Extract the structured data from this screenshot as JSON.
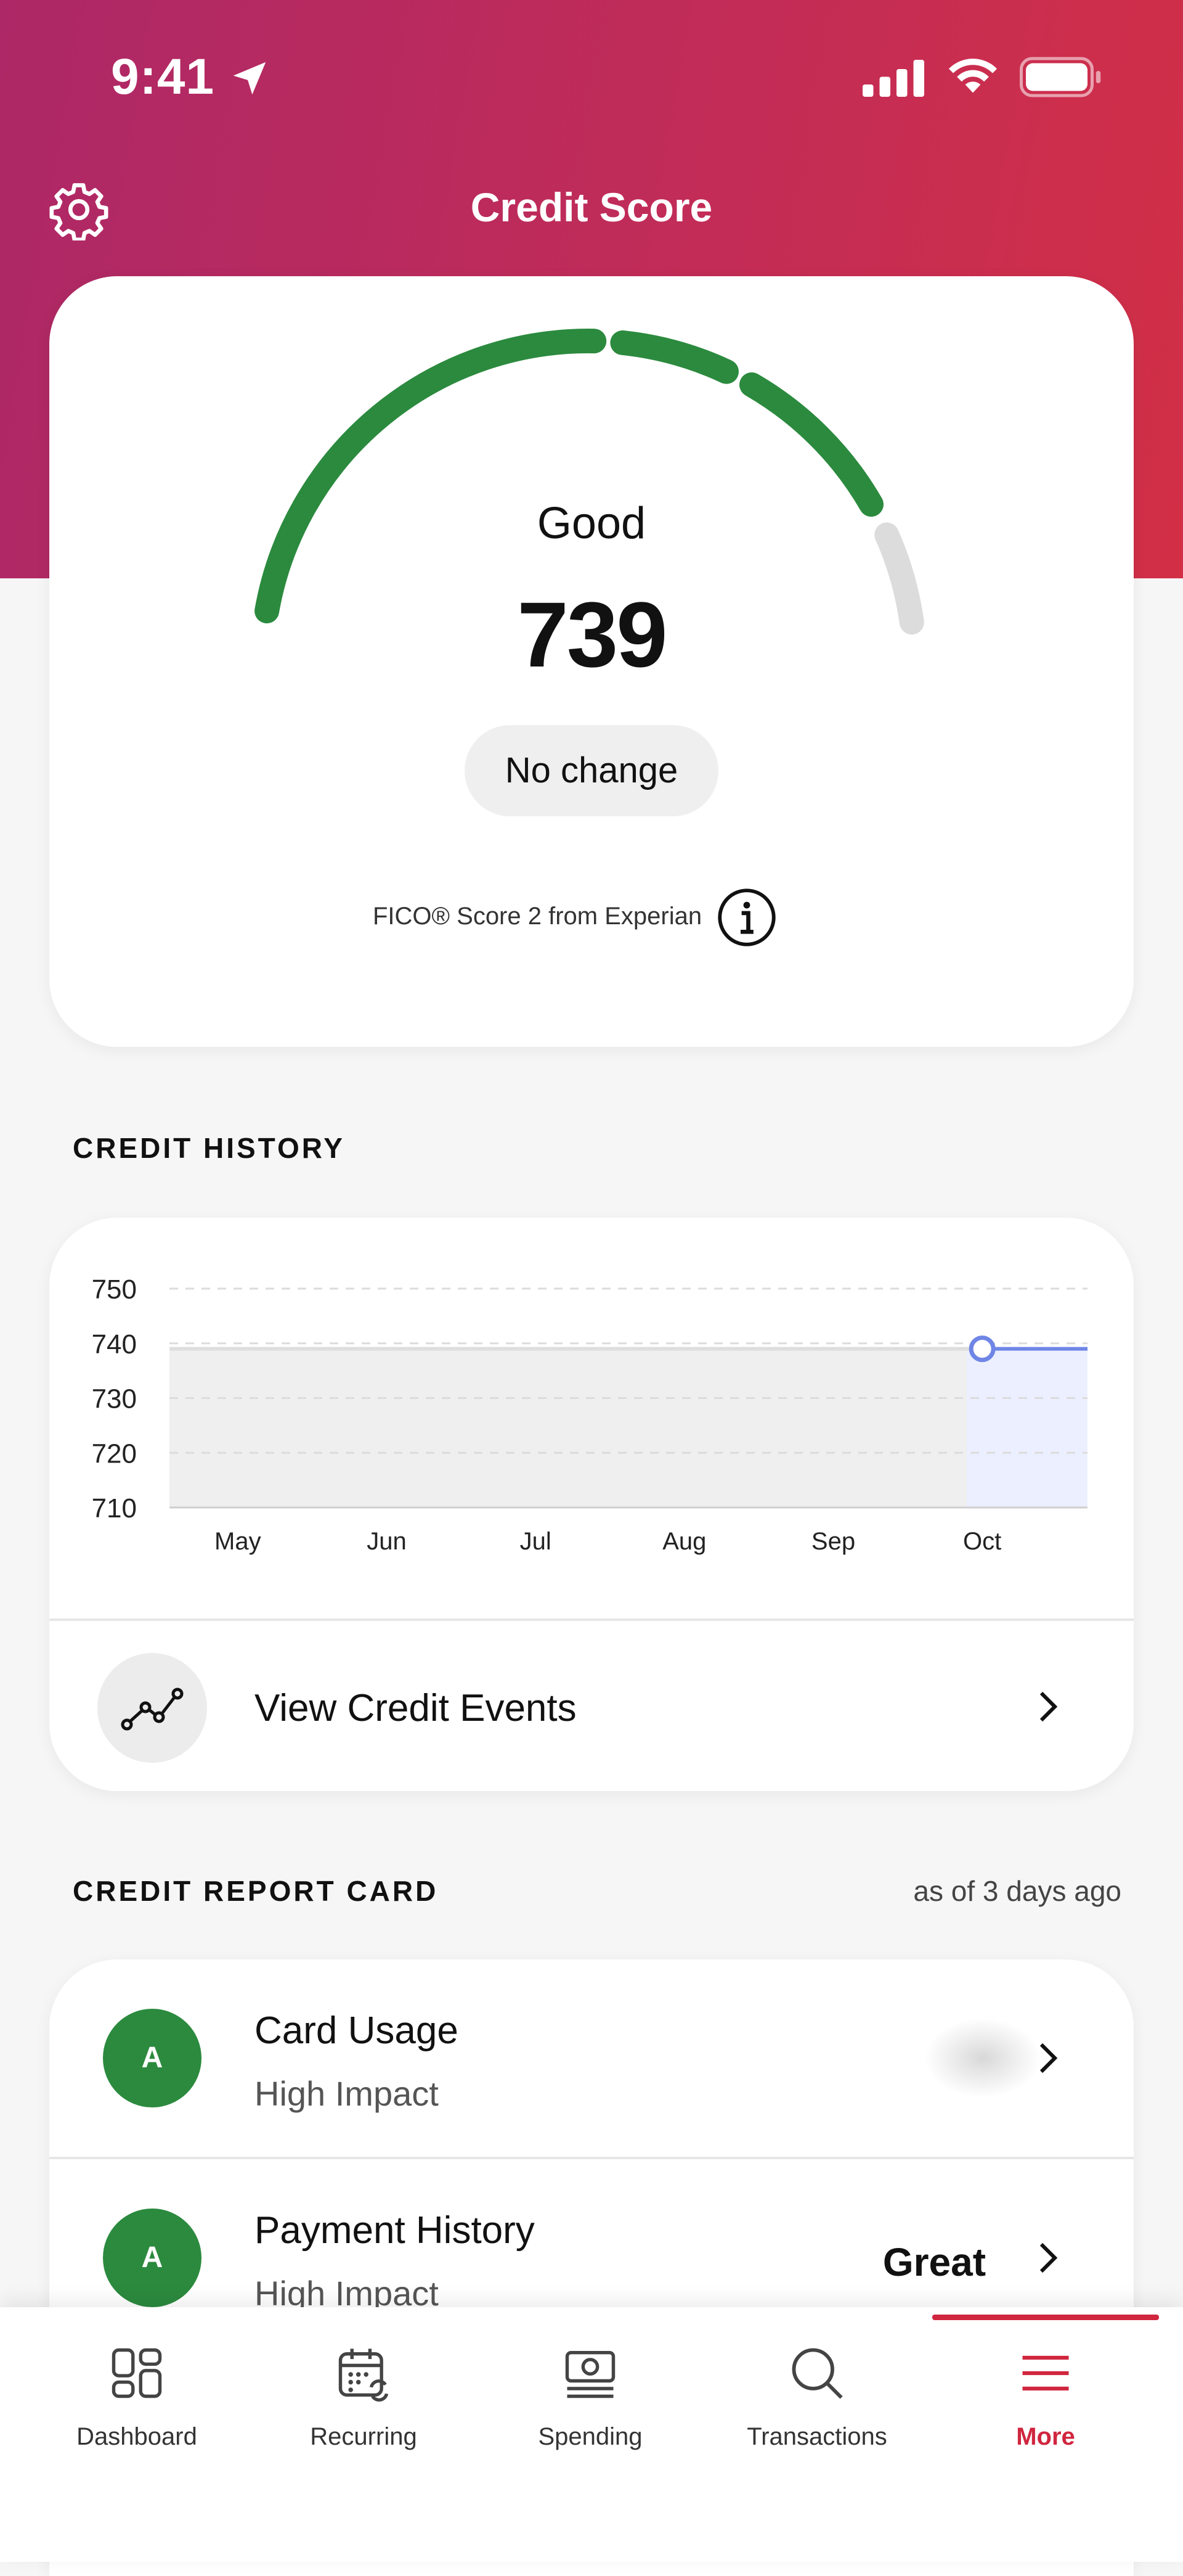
{
  "status_bar": {
    "time": "9:41"
  },
  "header": {
    "title": "Credit Score"
  },
  "score": {
    "label": "Good",
    "value": "739",
    "change": "No change",
    "source": "FICO® Score 2 from Experian",
    "gauge_color": "#2b8a3e"
  },
  "credit_history": {
    "section_title": "CREDIT HISTORY",
    "view_events_label": "View Credit Events"
  },
  "chart_data": {
    "type": "area",
    "categories": [
      "May",
      "Jun",
      "Jul",
      "Aug",
      "Sep",
      "Oct"
    ],
    "series": [
      {
        "values": [
          739,
          739,
          739,
          739,
          739,
          739
        ]
      }
    ],
    "highlighted_point": {
      "category": "Oct",
      "value": 739
    },
    "yticks": [
      750,
      740,
      730,
      720,
      710
    ],
    "ylim": [
      710,
      750
    ],
    "grid": true,
    "line_color": "#6f86e6"
  },
  "credit_report": {
    "section_title": "CREDIT REPORT CARD",
    "as_of": "as of 3 days ago",
    "items": [
      {
        "grade": "A",
        "title": "Card Usage",
        "impact": "High Impact",
        "value": ""
      },
      {
        "grade": "A",
        "title": "Payment History",
        "impact": "High Impact",
        "value": "Great"
      }
    ]
  },
  "tab_bar": {
    "tabs": [
      {
        "label": "Dashboard",
        "icon": "dashboard-icon"
      },
      {
        "label": "Recurring",
        "icon": "calendar-recurring-icon"
      },
      {
        "label": "Spending",
        "icon": "cash-icon"
      },
      {
        "label": "Transactions",
        "icon": "search-icon"
      },
      {
        "label": "More",
        "icon": "menu-icon"
      }
    ],
    "active": "More",
    "active_color": "#d0263f"
  }
}
